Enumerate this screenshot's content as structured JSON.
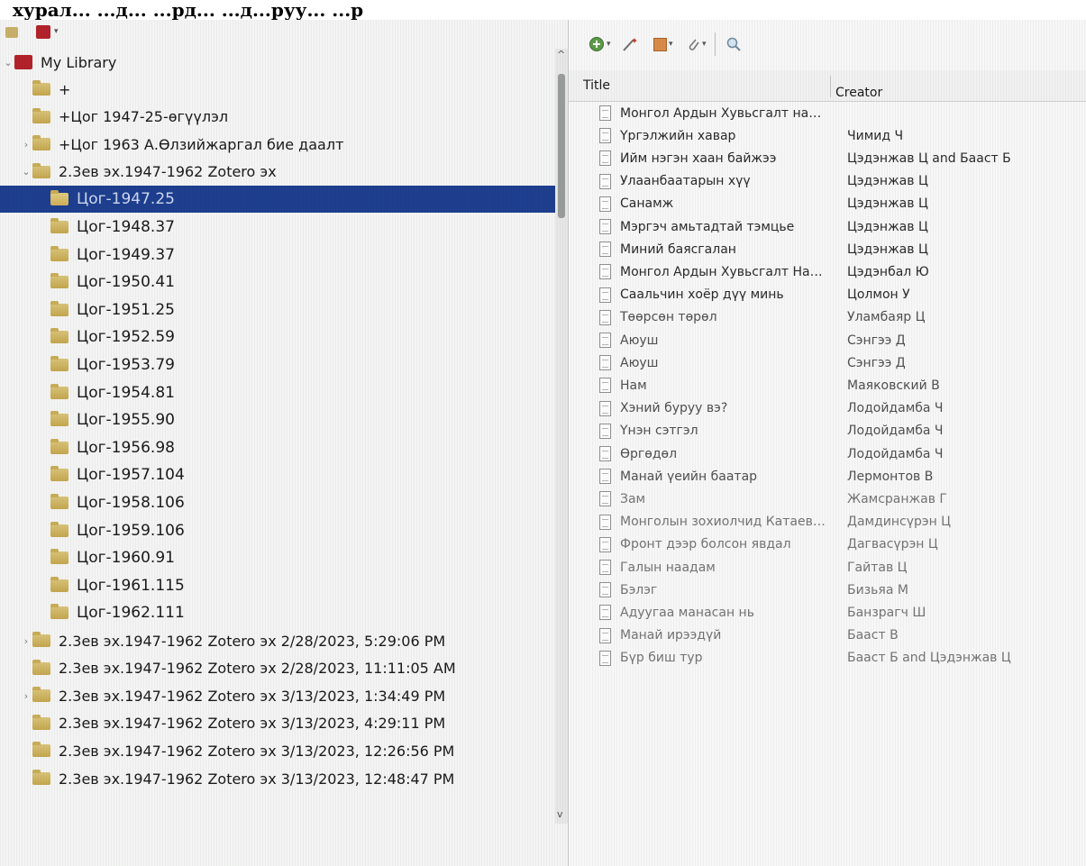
{
  "caption": "хурал... ...д... ...рд... ...д...руу... ...р",
  "collections": {
    "library_label": "My Library",
    "items": [
      {
        "label": "+",
        "depth": 1,
        "twisty": ""
      },
      {
        "label": "+Цог 1947-25-өгүүлэл",
        "depth": 1,
        "twisty": ""
      },
      {
        "label": "+Цог 1963 А.Өлзийжаргал бие даалт",
        "depth": 1,
        "twisty": "›"
      },
      {
        "label": "2.3ев эх.1947-1962 Zotero эх",
        "depth": 1,
        "twisty": "⌄"
      },
      {
        "label": "Цог-1947.25",
        "depth": 2,
        "twisty": "",
        "selected": true
      },
      {
        "label": "Цог-1948.37",
        "depth": 2,
        "twisty": ""
      },
      {
        "label": "Цог-1949.37",
        "depth": 2,
        "twisty": ""
      },
      {
        "label": "Цог-1950.41",
        "depth": 2,
        "twisty": ""
      },
      {
        "label": "Цог-1951.25",
        "depth": 2,
        "twisty": ""
      },
      {
        "label": "Цог-1952.59",
        "depth": 2,
        "twisty": ""
      },
      {
        "label": "Цог-1953.79",
        "depth": 2,
        "twisty": ""
      },
      {
        "label": "Цог-1954.81",
        "depth": 2,
        "twisty": ""
      },
      {
        "label": "Цог-1955.90",
        "depth": 2,
        "twisty": ""
      },
      {
        "label": "Цог-1956.98",
        "depth": 2,
        "twisty": ""
      },
      {
        "label": "Цог-1957.104",
        "depth": 2,
        "twisty": ""
      },
      {
        "label": "Цог-1958.106",
        "depth": 2,
        "twisty": ""
      },
      {
        "label": "Цог-1959.106",
        "depth": 2,
        "twisty": ""
      },
      {
        "label": "Цог-1960.91",
        "depth": 2,
        "twisty": ""
      },
      {
        "label": "Цог-1961.115",
        "depth": 2,
        "twisty": ""
      },
      {
        "label": "Цог-1962.111",
        "depth": 2,
        "twisty": ""
      },
      {
        "label": "2.3ев эх.1947-1962 Zotero эх 2/28/2023, 5:29:06 PM",
        "depth": 1,
        "twisty": "›"
      },
      {
        "label": "2.3ев эх.1947-1962 Zotero эх 2/28/2023, 11:11:05 AM",
        "depth": 1,
        "twisty": ""
      },
      {
        "label": "2.3ев эх.1947-1962 Zotero эх 3/13/2023, 1:34:49 PM",
        "depth": 1,
        "twisty": "›"
      },
      {
        "label": "2.3ев эх.1947-1962 Zotero эх 3/13/2023, 4:29:11 PM",
        "depth": 1,
        "twisty": ""
      },
      {
        "label": "2.3ев эх.1947-1962 Zotero эх 3/13/2023, 12:26:56 PM",
        "depth": 1,
        "twisty": ""
      },
      {
        "label": "2.3ев эх.1947-1962 Zotero эх 3/13/2023, 12:48:47 PM",
        "depth": 1,
        "twisty": ""
      }
    ]
  },
  "items_table": {
    "columns": {
      "title": "Title",
      "creator": "Creator"
    },
    "rows": [
      {
        "title": "Монгол Ардын Хувьсгалт намын ...",
        "creator": ""
      },
      {
        "title": "Үргэлжийн хавар",
        "creator": "Чимид Ч"
      },
      {
        "title": "Ийм нэгэн хаан байжээ",
        "creator": "Цэдэнжав Ц and Бааст Б"
      },
      {
        "title": "Улаанбаатарын хүү",
        "creator": "Цэдэнжав Ц"
      },
      {
        "title": "Санамж",
        "creator": "Цэдэнжав Ц"
      },
      {
        "title": "Мэргэч амьтадтай тэмцье",
        "creator": "Цэдэнжав Ц"
      },
      {
        "title": "Миний баясгалан",
        "creator": "Цэдэнжав Ц"
      },
      {
        "title": "Монгол Ардын Хувьсгалт Намын ...",
        "creator": "Цэдэнбал Ю"
      },
      {
        "title": "Саальчин хоёр дүү минь",
        "creator": "Цолмон У"
      },
      {
        "title": "Төөрсөн төрөл",
        "creator": "Уламбаяр Ц"
      },
      {
        "title": "Аюуш",
        "creator": "Сэнгээ Д"
      },
      {
        "title": "Аюуш",
        "creator": "Сэнгээ Д"
      },
      {
        "title": "Нам",
        "creator": "Маяковский В"
      },
      {
        "title": "Хэний буруу вэ?",
        "creator": "Лодойдамба Ч"
      },
      {
        "title": "Үнэн сэтгэл",
        "creator": "Лодойдамба Ч"
      },
      {
        "title": "Өргөдөл",
        "creator": "Лодойдамба Ч"
      },
      {
        "title": "Манай үеийн баатар",
        "creator": "Лермонтов В"
      },
      {
        "title": "Зам",
        "creator": "Жамсранжав Г"
      },
      {
        "title": "Монголын зохиолчид Катаевтай у...",
        "creator": "Дамдинсүрэн Ц"
      },
      {
        "title": "Фронт дээр болсон явдал",
        "creator": "Дагвасүрэн Ц"
      },
      {
        "title": "Галын наадам",
        "creator": "Гайтав Ц"
      },
      {
        "title": "Бэлэг",
        "creator": "Бизьяа М"
      },
      {
        "title": "Адуугаа манасан нь",
        "creator": "Банзрагч Ш"
      },
      {
        "title": "Манай ирээдүй",
        "creator": "Бааст В"
      },
      {
        "title": "Бүр биш тур",
        "creator": "Бааст Б and Цэдэнжав Ц"
      }
    ]
  },
  "colors": {
    "selection": "#1e3f8f",
    "library_icon": "#b3222a",
    "folder": "#d2b862"
  }
}
